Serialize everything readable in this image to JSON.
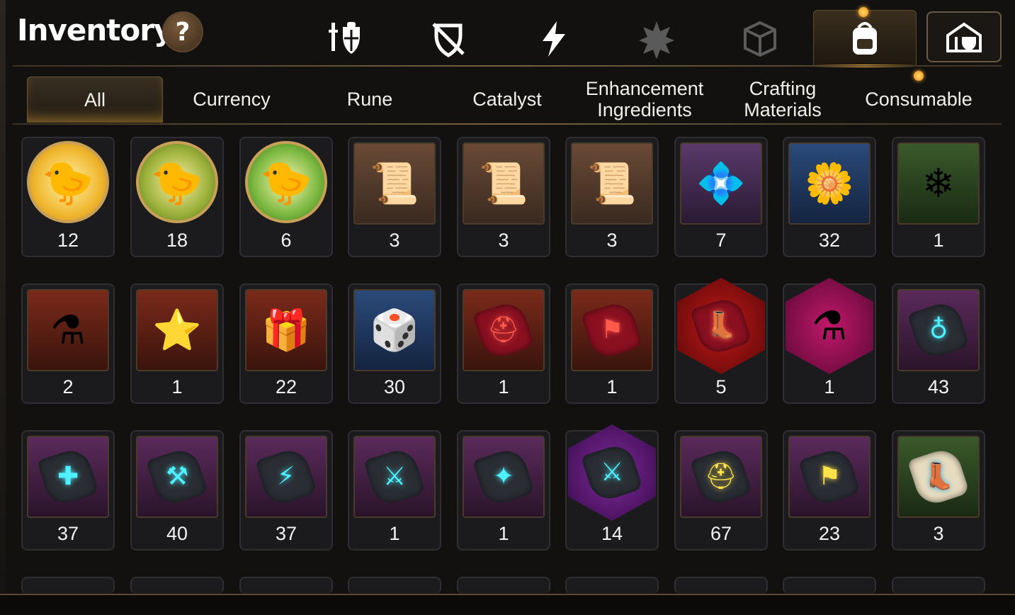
{
  "header": {
    "title": "Inventory",
    "help_label": "?"
  },
  "top_tabs": [
    {
      "icon": "gear-helmet-icon",
      "label": ""
    },
    {
      "icon": "disabled-shield-icon",
      "label": ""
    },
    {
      "icon": "lightning-icon",
      "label": ""
    },
    {
      "icon": "burst-icon",
      "label": ""
    },
    {
      "icon": "dice-icon",
      "label": ""
    },
    {
      "icon": "backpack-icon",
      "label": ""
    },
    {
      "icon": "guild-house-icon",
      "label": ""
    }
  ],
  "sub_tabs": [
    "All",
    "Currency",
    "Rune",
    "Catalyst",
    "Enhancement Ingredients",
    "Crafting Materials",
    "Consumable"
  ],
  "colors": {
    "accent": "#f2b23a",
    "text": "#ffffff",
    "frame": "#5a4a32"
  },
  "items": [
    {
      "count": "12",
      "icon": "gold-chick-token-icon"
    },
    {
      "count": "18",
      "icon": "ranger-chick-token-icon"
    },
    {
      "count": "6",
      "icon": "laurel-chick-token-icon"
    },
    {
      "count": "3",
      "icon": "dragon-upgrade-scroll-icon"
    },
    {
      "count": "3",
      "icon": "rainbow-upgrade-scroll-icon"
    },
    {
      "count": "3",
      "icon": "gold-upgrade-scroll-icon"
    },
    {
      "count": "7",
      "icon": "purple-crystal-flower-icon"
    },
    {
      "count": "32",
      "icon": "gold-crystal-flower-icon"
    },
    {
      "count": "1",
      "icon": "silver-crystal-flower-icon"
    },
    {
      "count": "2",
      "icon": "red-potion-icon"
    },
    {
      "count": "1",
      "icon": "star-potion-icon"
    },
    {
      "count": "22",
      "icon": "gold-cube-icon"
    },
    {
      "count": "30",
      "icon": "silver-cube-icon"
    },
    {
      "count": "1",
      "icon": "red-ring-rune-icon"
    },
    {
      "count": "1",
      "icon": "red-necklace-rune-icon"
    },
    {
      "count": "5",
      "icon": "red-star-rune-icon"
    },
    {
      "count": "1",
      "icon": "pink-potion-icon"
    },
    {
      "count": "43",
      "icon": "teal-sword-rune-icon"
    },
    {
      "count": "37",
      "icon": "teal-helmet-rune-icon"
    },
    {
      "count": "40",
      "icon": "teal-armor-rune-icon"
    },
    {
      "count": "37",
      "icon": "teal-boot-rune-icon"
    },
    {
      "count": "1",
      "icon": "teal-ring-rune-icon"
    },
    {
      "count": "1",
      "icon": "teal-necklace-rune-icon"
    },
    {
      "count": "14",
      "icon": "purple-star-rune-icon"
    },
    {
      "count": "67",
      "icon": "gold-hammer-rune-icon"
    },
    {
      "count": "23",
      "icon": "gold-bolt-rune-icon"
    },
    {
      "count": "3",
      "icon": "stone-sword-rune-icon"
    }
  ]
}
